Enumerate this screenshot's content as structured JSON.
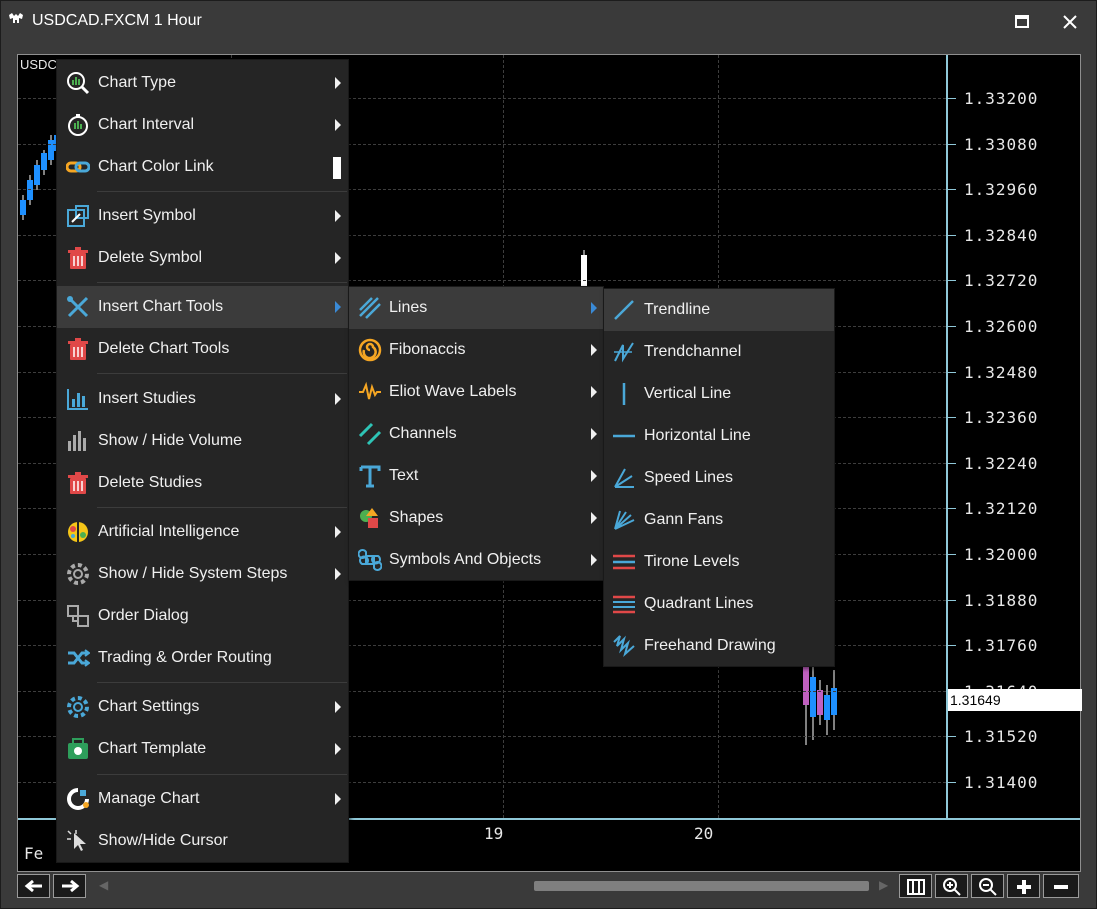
{
  "window": {
    "title": "USDCAD.FXCM 1 Hour",
    "logo_icon": "bull-bear-logo-icon",
    "maximize_icon": "maximize-icon",
    "close_icon": "close-icon"
  },
  "chart": {
    "symbol_label": "USDC",
    "y_labels": [
      "1.33200",
      "1.33080",
      "1.32960",
      "1.32840",
      "1.32720",
      "1.32600",
      "1.32480",
      "1.32360",
      "1.32240",
      "1.32120",
      "1.32000",
      "1.31880",
      "1.31760",
      "1.31640",
      "1.31520",
      "1.31400"
    ],
    "current_price": "1.31649",
    "x_labels": [
      "Fe",
      "19",
      "20"
    ],
    "accent_color": "#8fc8d8",
    "up_color": "#1e90ff",
    "down_color": "#c060c0"
  },
  "menu_main": {
    "items": [
      {
        "label": "Chart Type",
        "icon": "chart-type-magnifier-icon",
        "submenu": true
      },
      {
        "label": "Chart Interval",
        "icon": "stopwatch-icon",
        "submenu": true
      },
      {
        "label": "Chart Color Link",
        "icon": "chain-link-icon",
        "submenu": false
      },
      {
        "label": "Insert Symbol",
        "icon": "insert-symbol-icon",
        "submenu": true
      },
      {
        "label": "Delete Symbol",
        "icon": "trash-icon",
        "submenu": true
      },
      {
        "label": "Insert Chart Tools",
        "icon": "crossed-tools-icon",
        "submenu": true
      },
      {
        "label": "Delete Chart Tools",
        "icon": "trash-icon",
        "submenu": false
      },
      {
        "label": "Insert Studies",
        "icon": "bar-chart-icon",
        "submenu": true
      },
      {
        "label": "Show / Hide Volume",
        "icon": "volume-bars-icon",
        "submenu": false
      },
      {
        "label": "Delete Studies",
        "icon": "trash-icon",
        "submenu": false
      },
      {
        "label": "Artificial Intelligence",
        "icon": "brain-icon",
        "submenu": true
      },
      {
        "label": "Show / Hide System Steps",
        "icon": "gear-steps-icon",
        "submenu": true
      },
      {
        "label": "Order Dialog",
        "icon": "order-dialog-icon",
        "submenu": false
      },
      {
        "label": "Trading & Order Routing",
        "icon": "routing-arrows-icon",
        "submenu": false
      },
      {
        "label": "Chart Settings",
        "icon": "settings-gear-icon",
        "submenu": true
      },
      {
        "label": "Chart Template",
        "icon": "template-icon",
        "submenu": true
      },
      {
        "label": "Manage Chart",
        "icon": "manage-chart-icon",
        "submenu": true
      },
      {
        "label": "Show/Hide Cursor",
        "icon": "cursor-icon",
        "submenu": false
      }
    ]
  },
  "menu_tools": {
    "items": [
      {
        "label": "Lines",
        "icon": "lines-icon"
      },
      {
        "label": "Fibonaccis",
        "icon": "fibonacci-spiral-icon"
      },
      {
        "label": "Eliot Wave Labels",
        "icon": "wave-icon"
      },
      {
        "label": "Channels",
        "icon": "channels-icon"
      },
      {
        "label": "Text",
        "icon": "text-t-icon"
      },
      {
        "label": "Shapes",
        "icon": "shapes-icon"
      },
      {
        "label": "Symbols And Objects",
        "icon": "command-symbol-icon"
      }
    ]
  },
  "menu_lines": {
    "items": [
      {
        "label": "Trendline",
        "icon": "trendline-icon"
      },
      {
        "label": "Trendchannel",
        "icon": "trendchannel-icon"
      },
      {
        "label": "Vertical Line",
        "icon": "vertical-line-icon"
      },
      {
        "label": "Horizontal Line",
        "icon": "horizontal-line-icon"
      },
      {
        "label": "Speed Lines",
        "icon": "speed-lines-icon"
      },
      {
        "label": "Gann Fans",
        "icon": "gann-fan-icon"
      },
      {
        "label": "Tirone Levels",
        "icon": "tirone-levels-icon"
      },
      {
        "label": "Quadrant Lines",
        "icon": "quadrant-lines-icon"
      },
      {
        "label": "Freehand Drawing",
        "icon": "freehand-icon"
      }
    ]
  },
  "toolbar": {
    "prev_icon": "arrow-left-icon",
    "next_icon": "arrow-right-icon",
    "fit_icon": "fit-columns-icon",
    "zoom_in_icon": "zoom-in-icon",
    "zoom_out_icon": "zoom-out-icon",
    "plus_icon": "plus-icon",
    "minus_icon": "minus-icon"
  }
}
